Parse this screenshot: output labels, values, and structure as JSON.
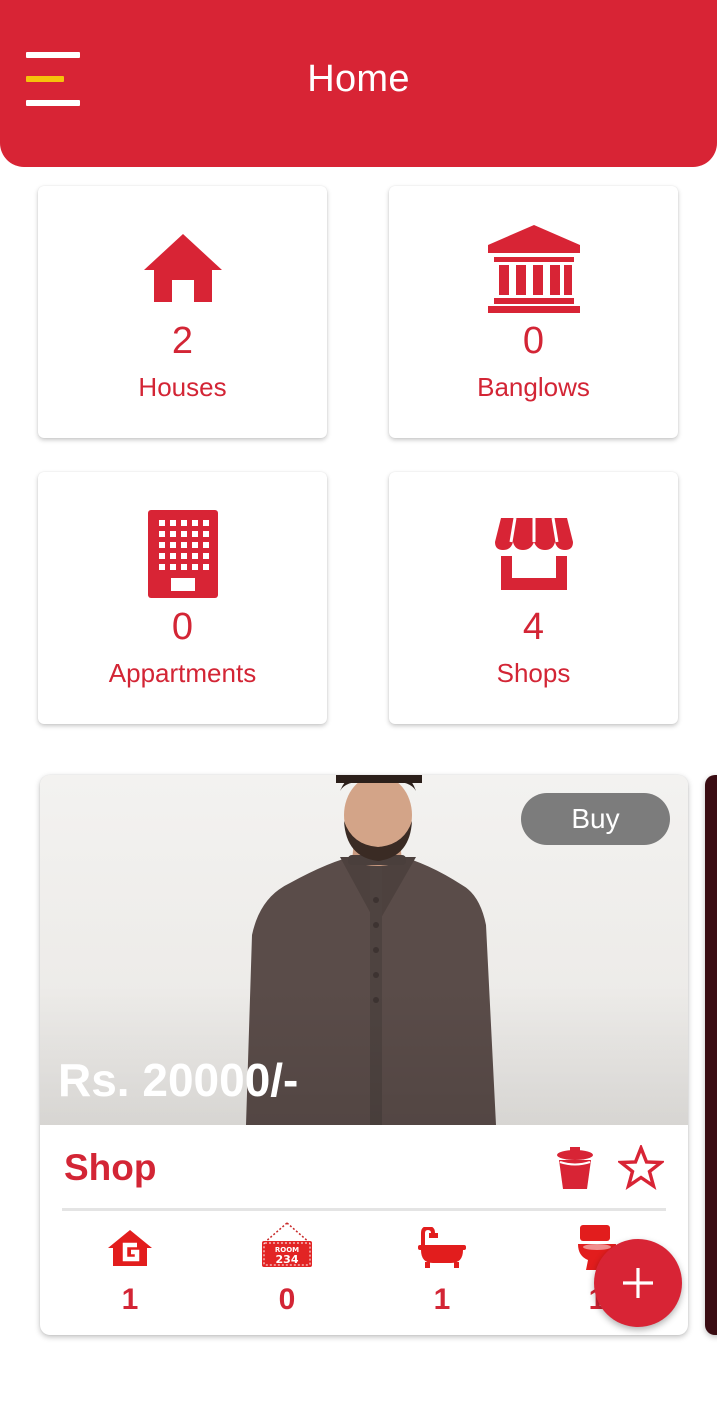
{
  "header": {
    "title": "Home",
    "menu_icon": "hamburger-menu-icon"
  },
  "stats": [
    {
      "icon": "house-icon",
      "count": "2",
      "label": "Houses"
    },
    {
      "icon": "bank-building-icon",
      "count": "0",
      "label": "Banglows"
    },
    {
      "icon": "apartment-building-icon",
      "count": "0",
      "label": "Appartments"
    },
    {
      "icon": "storefront-icon",
      "count": "4",
      "label": "Shops"
    }
  ],
  "listing": {
    "buy_label": "Buy",
    "price": "Rs. 20000/-",
    "type": "Shop",
    "features": [
      {
        "icon": "ground-floor-icon",
        "value": "1"
      },
      {
        "icon": "room-number-sign-icon",
        "value": "0",
        "room_sign_text": "ROOM",
        "room_number": "234"
      },
      {
        "icon": "bathtub-icon",
        "value": "1"
      },
      {
        "icon": "toilet-icon",
        "value": "1"
      }
    ]
  },
  "colors": {
    "primary": "#d82435",
    "accent_yellow": "#f6c20b",
    "buy_button": "#7c7c7c"
  }
}
